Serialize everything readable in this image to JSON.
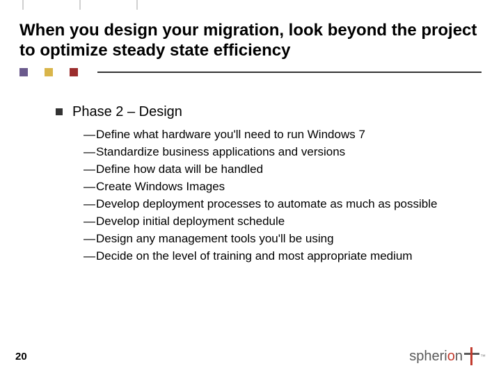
{
  "title": "When you design your migration, look beyond the project to optimize steady state efficiency",
  "phase_label": "Phase 2 – Design",
  "items": [
    "Define what hardware you'll need to run Windows 7",
    "Standardize business applications and versions",
    "Define how data will be handled",
    "Create Windows Images",
    "Develop deployment processes to automate as much as possible",
    "Develop initial deployment schedule",
    "Design any management tools you'll be using",
    "Decide on the level of training and most appropriate medium"
  ],
  "page_number": "20",
  "logo": {
    "prefix": "spheri",
    "accent": "o",
    "suffix": "n",
    "tm": "™"
  },
  "top_tick_positions": [
    32,
    114,
    196
  ]
}
